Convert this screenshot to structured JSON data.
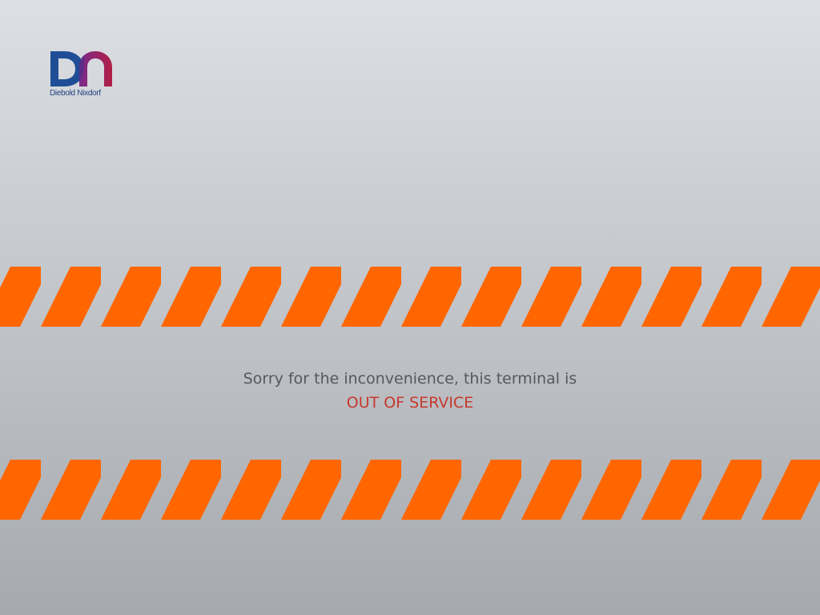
{
  "brand": {
    "logo_text": "Diebold Nixdorf",
    "logo_icon": "dn-logo-icon",
    "colors": {
      "navy": "#1f4e96",
      "crimson": "#b01e46",
      "purple": "#6a2a8a"
    }
  },
  "hazard": {
    "stripe_color": "#ff6600"
  },
  "message": {
    "line1": "Sorry for the inconvenience, this terminal is",
    "status": "OUT OF SERVICE"
  }
}
